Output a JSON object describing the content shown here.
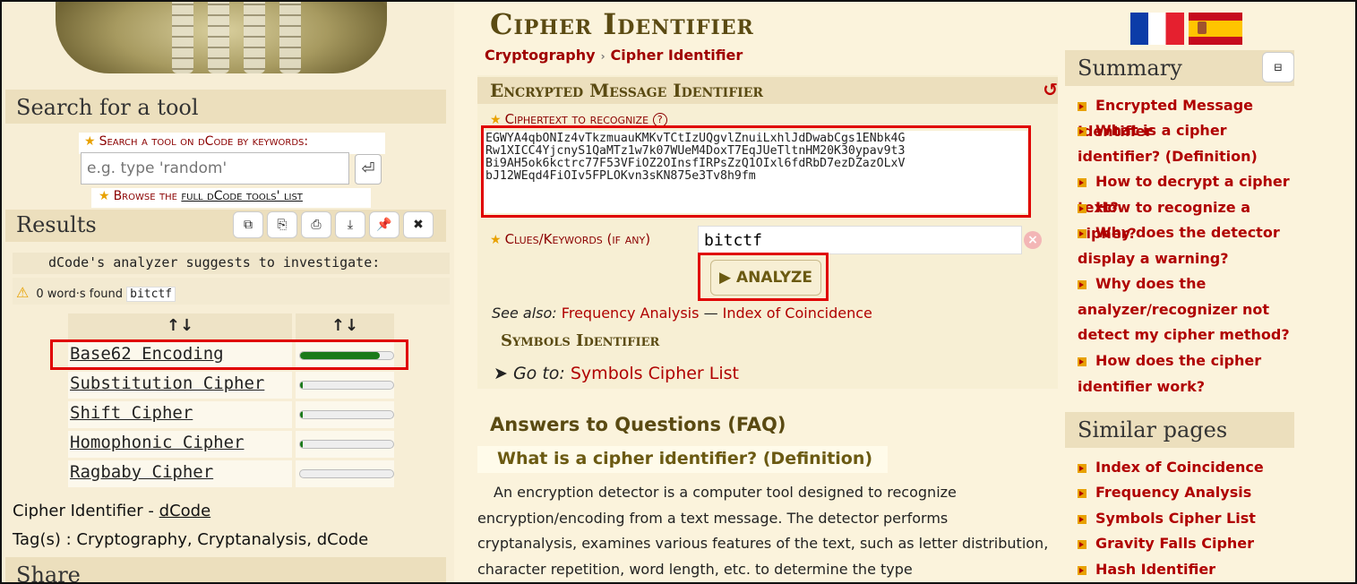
{
  "sidebar": {
    "search_title": "Search for a tool",
    "search_label": "Search a tool on dCode by keywords:",
    "search_placeholder": "e.g. type 'random'",
    "search_button": "⏎",
    "browse_prefix": "Browse the ",
    "browse_link": "full dCode tools' list",
    "results_title": "Results",
    "tool_buttons": [
      "⧉",
      "⎘",
      "⎙",
      "⤓",
      "📌",
      "✖"
    ],
    "suggest_text": "dCode's analyzer suggests to investigate:",
    "found_text": "0 word·s found",
    "found_keyword": "bitctf",
    "col_sort_1": "↑↓",
    "col_sort_2": "↑↓",
    "results": [
      {
        "name": "Base62 Encoding",
        "score": 0.86
      },
      {
        "name": "Substitution Cipher",
        "score": 0.03
      },
      {
        "name": "Shift Cipher",
        "score": 0.03
      },
      {
        "name": "Homophonic Cipher",
        "score": 0.03
      },
      {
        "name": "Ragbaby Cipher",
        "score": 0.0
      }
    ],
    "page_name": "Cipher Identifier - ",
    "page_site": "dCode",
    "tags": "Tag(s) : Cryptography, Cryptanalysis, dCode",
    "share_title": "Share"
  },
  "main": {
    "title": "Cipher Identifier",
    "breadcrumb": [
      "Cryptography",
      "Cipher Identifier"
    ],
    "breadcrumb_sep": "›",
    "panel_title": "Encrypted Message Identifier",
    "reload_icon": "↺",
    "ciphertext_label": "Ciphertext to recognize",
    "help_icon": "?",
    "ciphertext": "EGWYA4qbONIz4vTkzmuauKMKvTCtIzUQgvlZnuiLxhlJdDwabCgs1ENbk4G\nRw1XICC4YjcnyS1QaMTz1w7k07WUeM4DoxT7EqJUeTltnHM20K30ypav9t3\nBi9AH5ok6kctrc77F53VFiOZ2OInsfIRPsZzQ1OIxl6fdRbD7ezDZazOLxV\nbJ12WEqd4FiOIv5FPLOKvn3sKN875e3Tv8h9fm",
    "clues_label": "Clues/Keywords (if any)",
    "clues_value": "bitctf",
    "clear_icon": "×",
    "analyze_label": "▶ ANALYZE",
    "see_also_label": "See also:",
    "see_also_1": "Frequency Analysis",
    "see_also_dash": "—",
    "see_also_2": "Index of Coincidence",
    "symbols_title": "Symbols Identifier",
    "goto_label": "➤ Go to:",
    "goto_link": "Symbols Cipher List",
    "faq_title": "Answers to Questions (FAQ)",
    "faq_q1": "What is a cipher identifier? (Definition)",
    "faq_a1": "An encryption detector is a computer tool designed to recognize encryption/encoding from a text message. The detector performs cryptanalysis, examines various features of the text, such as letter distribution, character repetition, word length, etc. to determine the type"
  },
  "right": {
    "summary_title": "Summary",
    "collapse_icon": "⊟",
    "summary_items": [
      "Encrypted Message Identifier",
      "What is a cipher identifier? (Definition)",
      "How to decrypt a cipher text?",
      "How to recognize a cipher?",
      "Why does the detector display a warning?",
      "Why does the analyzer/recognizer not detect my cipher method?",
      "How does the cipher identifier work?"
    ],
    "similar_title": "Similar pages",
    "similar_items": [
      "Index of Coincidence",
      "Frequency Analysis",
      "Symbols Cipher List",
      "Gravity Falls Cipher",
      "Hash Identifier"
    ]
  },
  "colors": {
    "accent_red": "#b00000",
    "highlight_box": "#e00000",
    "bar_green": "#1a7a1a",
    "title_brown": "#5a4a12"
  }
}
